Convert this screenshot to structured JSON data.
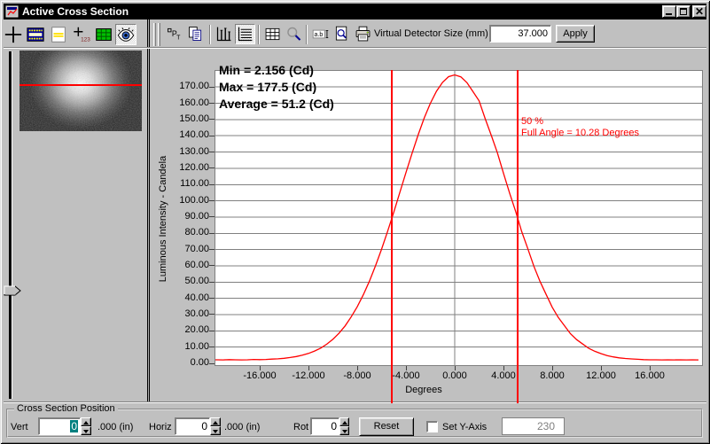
{
  "window": {
    "title": "Active Cross Section"
  },
  "titlebar": {
    "buttons": [
      "minimize",
      "maximize",
      "close"
    ]
  },
  "left_toolbar": {
    "icons": [
      "crosshair-icon",
      "detector-strip-icon",
      "slide-icon",
      "crosshair-values-icon",
      "green-grid-icon",
      "eye-icon"
    ],
    "pressed": "eye-icon"
  },
  "toolbar": {
    "icons": [
      "pt-icon",
      "copy-icon",
      "bar-chart-icon",
      "row-chart-icon",
      "table-grid-icon",
      "magnifier-icon",
      "ab-text-icon",
      "print-preview-icon",
      "printer-icon"
    ],
    "pressed": "row-chart-icon",
    "detector_label": "Virtual Detector Size (mm)",
    "detector_value": "37.000",
    "apply_label": "Apply"
  },
  "chart": {
    "annotations": {
      "min": "Min = 2.156 (Cd)",
      "max": "Max = 177.5 (Cd)",
      "average": "Average = 51.2 (Cd)"
    },
    "marker_label_percent": "50 %",
    "marker_label_angle": "Full Angle = 10.28 Degrees",
    "y_axis_title": "Luminous Intensity - Candela",
    "x_axis_title": "Degrees"
  },
  "chart_data": {
    "type": "line",
    "xlabel": "Degrees",
    "ylabel": "Luminous Intensity - Candela",
    "xlim": [
      -19.7,
      20.4
    ],
    "ylim": [
      0,
      180
    ],
    "grid": "horizontal plus center vertical",
    "x_ticks": [
      -16,
      -12,
      -8,
      -4,
      0,
      4,
      8,
      12,
      16
    ],
    "x_tick_labels": [
      "-16.000",
      "-12.000",
      "-8.000",
      "-4.000",
      "0.000",
      "4.000",
      "8.000",
      "12.000",
      "16.000"
    ],
    "y_ticks": [
      0,
      10,
      20,
      30,
      40,
      50,
      60,
      70,
      80,
      90,
      100,
      110,
      120,
      130,
      140,
      150,
      160,
      170
    ],
    "y_tick_labels": [
      "0.00",
      "10.00",
      "20.00",
      "30.00",
      "40.00",
      "50.00",
      "60.00",
      "70.00",
      "80.00",
      "90.00",
      "100.00",
      "110.00",
      "120.00",
      "130.00",
      "140.00",
      "150.00",
      "160.00",
      "170.00"
    ],
    "series": [
      {
        "name": "cross-section-profile",
        "color": "#ff0000",
        "points": [
          [
            -20,
            2.1
          ],
          [
            -19.5,
            2.2
          ],
          [
            -19,
            2.1
          ],
          [
            -18.5,
            2.3
          ],
          [
            -18,
            2.2
          ],
          [
            -17.5,
            2.1
          ],
          [
            -17,
            2.2
          ],
          [
            -16.5,
            2.4
          ],
          [
            -16,
            2.3
          ],
          [
            -15.5,
            2.4
          ],
          [
            -15,
            2.6
          ],
          [
            -14.5,
            2.8
          ],
          [
            -14,
            3.1
          ],
          [
            -13.5,
            3.6
          ],
          [
            -13,
            4.2
          ],
          [
            -12.5,
            5.0
          ],
          [
            -12,
            6.1
          ],
          [
            -11.5,
            7.6
          ],
          [
            -11,
            9.4
          ],
          [
            -10.5,
            11.8
          ],
          [
            -10,
            14.8
          ],
          [
            -9.5,
            18.5
          ],
          [
            -9,
            23.0
          ],
          [
            -8.5,
            28.5
          ],
          [
            -8,
            34.8
          ],
          [
            -7.5,
            42.2
          ],
          [
            -7,
            50.6
          ],
          [
            -6.5,
            60.0
          ],
          [
            -6,
            70.3
          ],
          [
            -5.5,
            81.4
          ],
          [
            -5,
            93.1
          ],
          [
            -4.5,
            105.2
          ],
          [
            -4,
            117.4
          ],
          [
            -3.5,
            129.3
          ],
          [
            -3,
            140.7
          ],
          [
            -2.5,
            151.0
          ],
          [
            -2,
            160.0
          ],
          [
            -1.5,
            167.4
          ],
          [
            -1,
            172.9
          ],
          [
            -0.5,
            176.4
          ],
          [
            0,
            177.5
          ],
          [
            0.5,
            176.3
          ],
          [
            1,
            172.7
          ],
          [
            1.5,
            167.2
          ],
          [
            2,
            161.5
          ],
          [
            2.5,
            150.5
          ],
          [
            3,
            140.2
          ],
          [
            3.5,
            129.6
          ],
          [
            4,
            117.0
          ],
          [
            4.5,
            104.8
          ],
          [
            5,
            93.4
          ],
          [
            5.5,
            81.0
          ],
          [
            6,
            70.5
          ],
          [
            6.5,
            59.6
          ],
          [
            7,
            50.3
          ],
          [
            7.5,
            42.4
          ],
          [
            8,
            34.5
          ],
          [
            8.5,
            28.2
          ],
          [
            9,
            23.2
          ],
          [
            9.5,
            18.2
          ],
          [
            10,
            14.6
          ],
          [
            10.5,
            11.9
          ],
          [
            11,
            9.2
          ],
          [
            11.5,
            7.4
          ],
          [
            12,
            6.0
          ],
          [
            12.5,
            4.8
          ],
          [
            13,
            4.0
          ],
          [
            13.5,
            3.4
          ],
          [
            14,
            3.0
          ],
          [
            14.5,
            2.7
          ],
          [
            15,
            2.5
          ],
          [
            15.5,
            2.3
          ],
          [
            16,
            2.2
          ],
          [
            16.5,
            2.2
          ],
          [
            17,
            2.1
          ],
          [
            17.5,
            2.2
          ],
          [
            18,
            2.1
          ],
          [
            18.5,
            2.2
          ],
          [
            19,
            2.1
          ],
          [
            19.5,
            2.2
          ],
          [
            20,
            2.1
          ]
        ]
      }
    ],
    "markers": {
      "vlines_deg": [
        -5.14,
        5.14
      ],
      "color": "#ff0000"
    },
    "stats": {
      "min_cd": 2.156,
      "max_cd": 177.5,
      "average_cd": 51.2,
      "full_angle_deg": 10.28,
      "half_level_percent": 50
    }
  },
  "bottom": {
    "group_label": "Cross Section Position",
    "vert": {
      "label": "Vert",
      "value": "0",
      "unit": ".000 (in)"
    },
    "horiz": {
      "label": "Horiz",
      "value": "0",
      "unit": ".000 (in)"
    },
    "rot": {
      "label": "Rot",
      "value": "0"
    },
    "reset_label": "Reset",
    "set_y_axis_label": "Set Y-Axis",
    "y_axis_value": "230"
  },
  "colors": {
    "window_bg": "#c0c0c0",
    "titlebar_bg": "#000000",
    "titlebar_text": "#ffffff",
    "plot_bg": "#ffffff",
    "gridline": "#808080",
    "curve": "#ff0000",
    "marker": "#ff0000",
    "selection": "#008080"
  }
}
